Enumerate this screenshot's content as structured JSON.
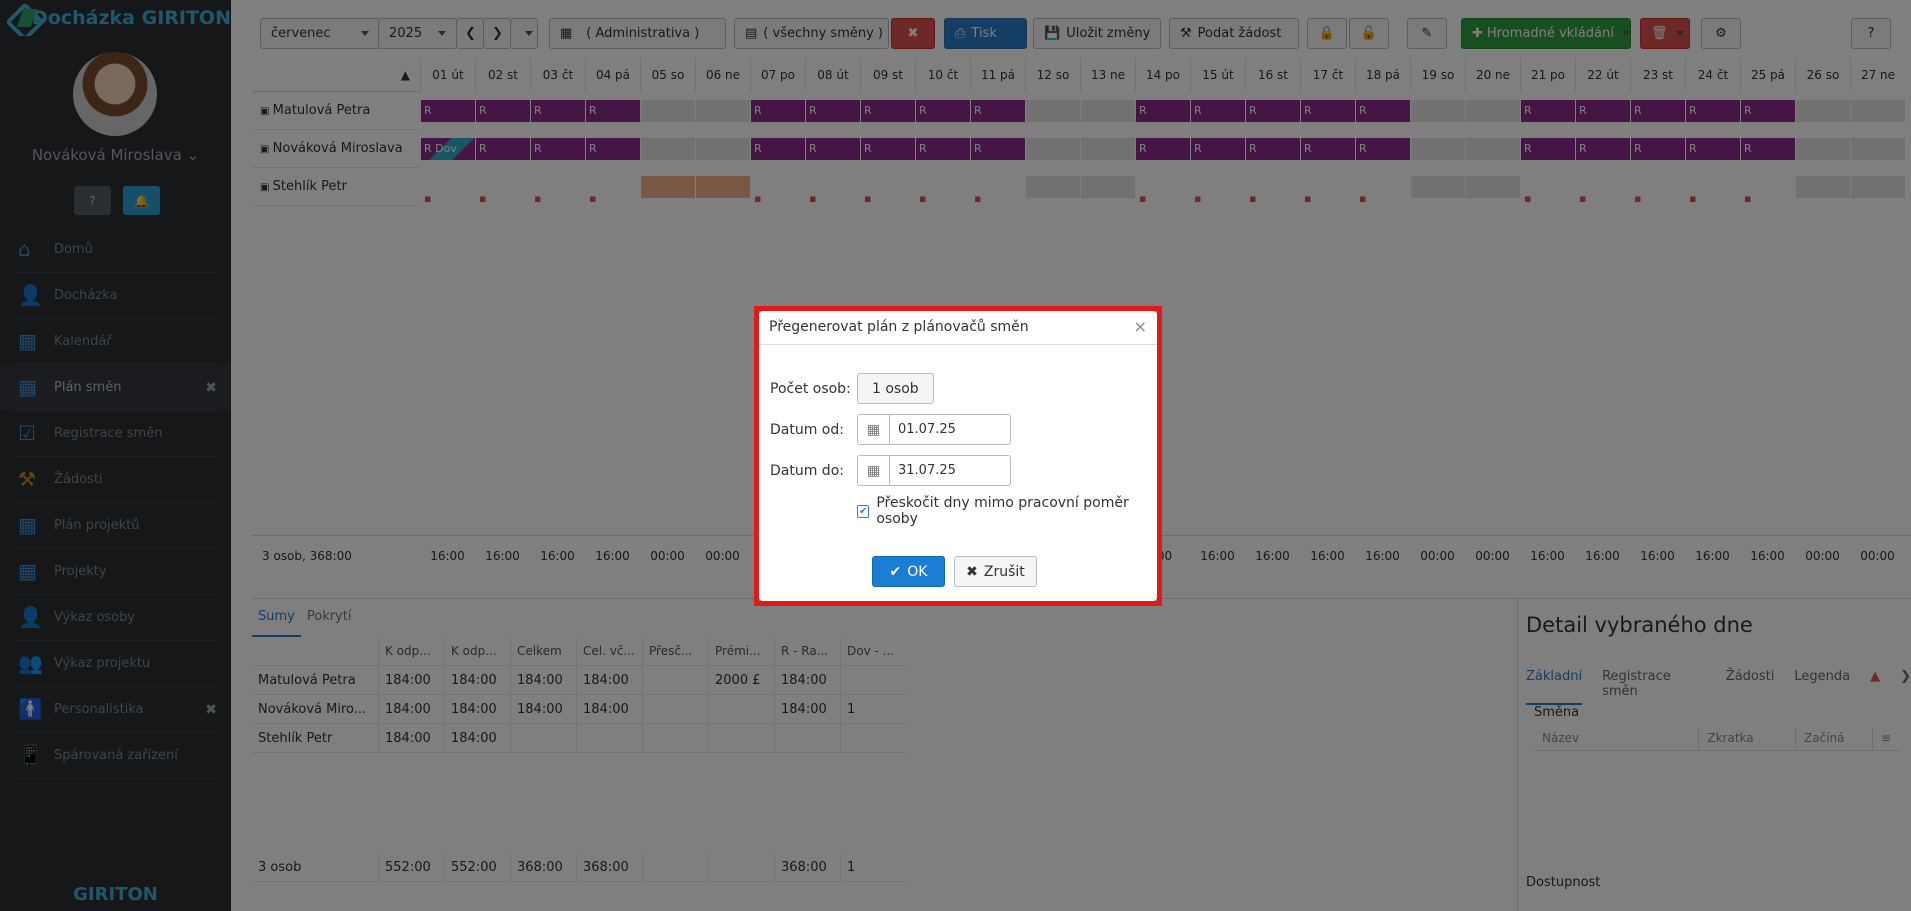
{
  "sidebar": {
    "brand": "Docházka GIRITON",
    "user_name": "Nováková Miroslava",
    "user_caret": "⌄",
    "help_icon": "❓",
    "bell_icon": "🔔",
    "items": [
      {
        "label": "Domů",
        "icon": "home-icon"
      },
      {
        "label": "Docházka",
        "icon": "user-icon"
      },
      {
        "label": "Kalendář",
        "icon": "calendar-icon"
      },
      {
        "label": "Plán směn",
        "icon": "calendar-grid-icon",
        "close": "✖"
      },
      {
        "label": "Registrace směn",
        "icon": "calendar-check-icon"
      },
      {
        "label": "Žádosti",
        "icon": "gavel-icon"
      },
      {
        "label": "Plán projektů",
        "icon": "calendar-grid-icon"
      },
      {
        "label": "Projekty",
        "icon": "calendar-icon"
      },
      {
        "label": "Výkaz osoby",
        "icon": "person-icon"
      },
      {
        "label": "Výkaz projektu",
        "icon": "group-icon"
      },
      {
        "label": "Personalistika",
        "icon": "standing-person-icon",
        "close": "✖"
      },
      {
        "label": "Spárovaná zařízení",
        "icon": "phone-icon"
      }
    ],
    "footer_brand": "GIRITON"
  },
  "toolbar": {
    "month": "červenec",
    "year": "2025",
    "prev": "❮",
    "next": "❯",
    "department": "( Administrativa )",
    "shifts": "( všechny směny )",
    "clear": "✖",
    "print": "Tisk",
    "save": "Uložit změny",
    "request": "Podat žádost",
    "bulk": "Hromadné vkládání",
    "help": "?"
  },
  "grid": {
    "days": [
      "01 út",
      "02 st",
      "03 čt",
      "04 pá",
      "05 so",
      "06 ne",
      "07 po",
      "08 út",
      "09 st",
      "10 čt",
      "11 pá",
      "12 so",
      "13 ne",
      "14 po",
      "15 út",
      "16 st",
      "17 čt",
      "18 pá",
      "19 so",
      "20 ne",
      "21 po",
      "22 út",
      "23 st",
      "24 čt",
      "25 pá",
      "26 so",
      "27 ne"
    ],
    "people": [
      "Matulová Petra",
      "Nováková Miroslava",
      "Stehlík Petr"
    ],
    "shift_code": "R",
    "vacation_code": "R Dov",
    "footer_label": "3 osob, 368:00",
    "footer_times": [
      "16:00",
      "16:00",
      "16:00",
      "16:00",
      "00:00",
      "00:00",
      "",
      "",
      "",
      "",
      "",
      "",
      "",
      "",
      "16:00",
      "16:00",
      "16:00",
      "16:00",
      "16:00",
      "00:00",
      "00:00",
      "16:00",
      "16:00",
      "16:00",
      "16:00",
      "16:00",
      "00:00",
      "00:00"
    ],
    "footer_time_left": [
      "16:00",
      "16:00",
      "16:00",
      "16:00",
      "00:00",
      "00:00"
    ],
    "footer_time_right": [
      ":00",
      "16:00",
      "16:00",
      "16:00",
      "16:00",
      "00:00",
      "00:00",
      "16:00",
      "16:00",
      "16:00",
      "16:00",
      "16:00",
      "00:00",
      "00:00"
    ]
  },
  "bottom": {
    "tabs": [
      "Sumy",
      "Pokrytí"
    ],
    "headers": [
      "",
      "K odp...",
      "K odp...",
      "Celkem",
      "Cel. vč...",
      "Přesč...",
      "Prémi...",
      "R - Ra...",
      "Dov - ..."
    ],
    "rows": [
      [
        "Matulová Petra",
        "184:00",
        "184:00",
        "184:00",
        "184:00",
        "",
        "2000 £",
        "184:00",
        ""
      ],
      [
        "Nováková Miro...",
        "184:00",
        "184:00",
        "184:00",
        "184:00",
        "",
        "",
        "184:00",
        "1"
      ],
      [
        "Stehlík Petr",
        "184:00",
        "184:00",
        "",
        "",
        "",
        "",
        "",
        ""
      ]
    ],
    "total": [
      "3 osob",
      "552:00",
      "552:00",
      "368:00",
      "368:00",
      "",
      "",
      "368:00",
      "1"
    ]
  },
  "detail": {
    "title": "Detail vybraného dne",
    "tabs": [
      "Základní",
      "Registrace směn",
      "Žádosti",
      "Legenda"
    ],
    "section": "Směna",
    "columns": [
      "Název",
      "Zkratka",
      "Začíná"
    ],
    "footer": "Dostupnost"
  },
  "dialog": {
    "title": "Přegenerovat plán z plánovačů směn",
    "close": "×",
    "count_label": "Počet osob:",
    "count_value": "1 osob",
    "from_label": "Datum od:",
    "from_value": "01.07.25",
    "to_label": "Datum do:",
    "to_value": "31.07.25",
    "checkbox_label": "Přeskočit dny mimo pracovní poměr osoby",
    "checkbox_checked": true,
    "ok": "OK",
    "cancel": "Zrušit"
  }
}
